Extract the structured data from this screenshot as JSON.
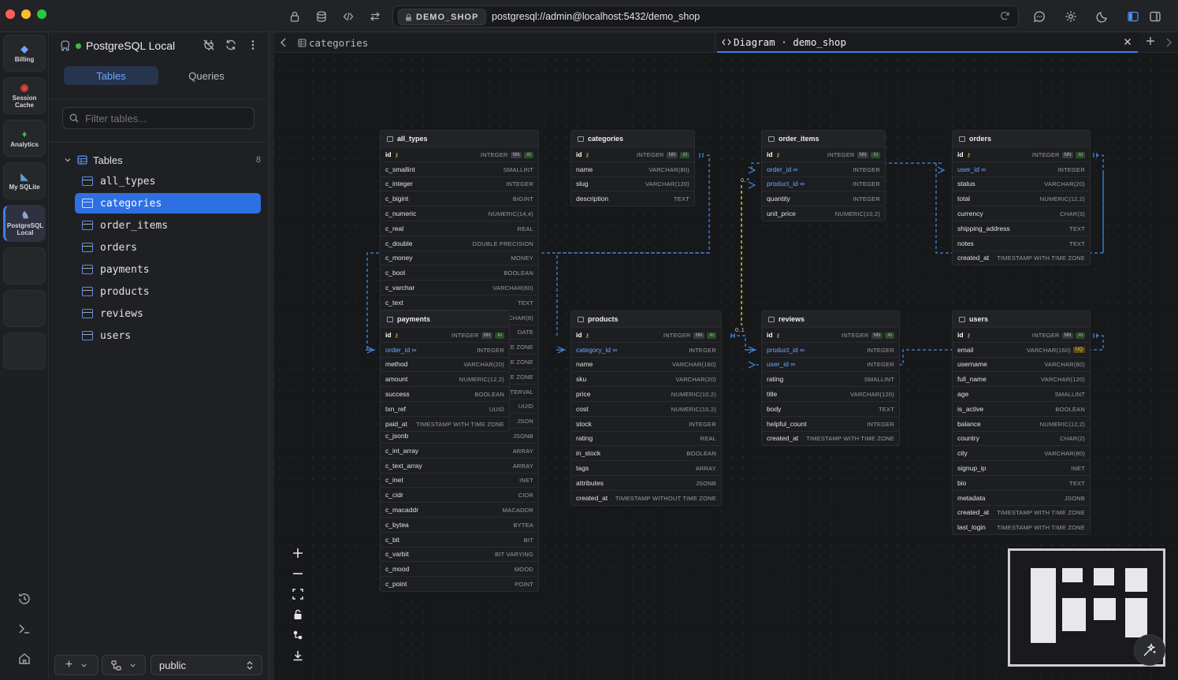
{
  "titlebar": {
    "connection_badge": "DEMO_SHOP",
    "url": "postgresql://admin@localhost:5432/demo_shop"
  },
  "activity_bar": {
    "items": [
      {
        "label": "Billing",
        "icon": "billing-icon"
      },
      {
        "label": "Session Cache",
        "icon": "redis-icon"
      },
      {
        "label": "Analytics",
        "icon": "leaf-icon"
      },
      {
        "label": "My SQLite",
        "icon": "sqlite-icon"
      },
      {
        "label": "PostgreSQL Local",
        "icon": "elephant-icon",
        "active": true
      }
    ]
  },
  "sidebar": {
    "connection_name": "PostgreSQL Local",
    "status_color": "#3fb950",
    "tabs": {
      "tables": "Tables",
      "queries": "Queries"
    },
    "filter_placeholder": "Filter tables...",
    "tree_header": {
      "label": "Tables",
      "count": "8"
    },
    "tables": [
      "all_types",
      "categories",
      "order_items",
      "orders",
      "payments",
      "products",
      "reviews",
      "users"
    ],
    "selected_table": "categories",
    "schema": "public"
  },
  "tabs": {
    "first": "categories",
    "active": "Diagram · demo_shop"
  },
  "diagram": {
    "all_types": {
      "name": "all_types",
      "columns": [
        {
          "n": "id",
          "t": "INTEGER",
          "nn": "NN",
          "ai": "AI"
        },
        {
          "n": "c_smallint",
          "t": "SMALLINT"
        },
        {
          "n": "c_integer",
          "t": "INTEGER"
        },
        {
          "n": "c_bigint",
          "t": "BIGINT"
        },
        {
          "n": "c_numeric",
          "t": "NUMERIC(14,4)"
        },
        {
          "n": "c_real",
          "t": "REAL"
        },
        {
          "n": "c_double",
          "t": "DOUBLE PRECISION"
        },
        {
          "n": "c_money",
          "t": "MONEY"
        },
        {
          "n": "c_bool",
          "t": "BOOLEAN"
        },
        {
          "n": "c_varchar",
          "t": "VARCHAR(60)"
        },
        {
          "n": "c_text",
          "t": "TEXT"
        },
        {
          "n": "",
          "t": "CHAR(8)"
        },
        {
          "n": "",
          "t": "DATE"
        },
        {
          "n": "",
          "t": "E ZONE"
        },
        {
          "n": "",
          "t": "E ZONE"
        },
        {
          "n": "",
          "t": "E ZONE"
        },
        {
          "n": "",
          "t": "TERVAL"
        },
        {
          "n": "",
          "t": "UUID"
        },
        {
          "n": "",
          "t": "JSON"
        },
        {
          "n": "c_jsonb",
          "t": "JSONB"
        },
        {
          "n": "c_int_array",
          "t": "ARRAY"
        },
        {
          "n": "c_text_array",
          "t": "ARRAY"
        },
        {
          "n": "c_inet",
          "t": "INET"
        },
        {
          "n": "c_cidr",
          "t": "CIDR"
        },
        {
          "n": "c_macaddr",
          "t": "MACADDR"
        },
        {
          "n": "c_bytea",
          "t": "BYTEA"
        },
        {
          "n": "c_bit",
          "t": "BIT"
        },
        {
          "n": "c_varbit",
          "t": "BIT VARYING"
        },
        {
          "n": "c_mood",
          "t": "MOOD"
        },
        {
          "n": "c_point",
          "t": "POINT"
        }
      ]
    },
    "categories": {
      "name": "categories",
      "columns": [
        {
          "n": "id",
          "t": "INTEGER",
          "nn": "NN",
          "ai": "AI"
        },
        {
          "n": "name",
          "t": "VARCHAR(80)"
        },
        {
          "n": "slug",
          "t": "VARCHAR(120)"
        },
        {
          "n": "description",
          "t": "TEXT"
        }
      ]
    },
    "order_items": {
      "name": "order_items",
      "columns": [
        {
          "n": "id",
          "t": "INTEGER",
          "nn": "NN",
          "ai": "AI"
        },
        {
          "n": "order_id",
          "t": "INTEGER",
          "fk": true
        },
        {
          "n": "product_id",
          "t": "INTEGER",
          "fk": true
        },
        {
          "n": "quantity",
          "t": "INTEGER"
        },
        {
          "n": "unit_price",
          "t": "NUMERIC(10,2)"
        }
      ]
    },
    "orders": {
      "name": "orders",
      "columns": [
        {
          "n": "id",
          "t": "INTEGER",
          "nn": "NN",
          "ai": "AI"
        },
        {
          "n": "user_id",
          "t": "INTEGER",
          "fk": true
        },
        {
          "n": "status",
          "t": "VARCHAR(20)"
        },
        {
          "n": "total",
          "t": "NUMERIC(12,2)"
        },
        {
          "n": "currency",
          "t": "CHAR(3)"
        },
        {
          "n": "shipping_address",
          "t": "TEXT"
        },
        {
          "n": "notes",
          "t": "TEXT"
        },
        {
          "n": "created_at",
          "t": "TIMESTAMP WITH TIME ZONE"
        }
      ]
    },
    "payments": {
      "name": "payments",
      "columns": [
        {
          "n": "id",
          "t": "INTEGER",
          "nn": "NN",
          "ai": "AI"
        },
        {
          "n": "order_id",
          "t": "INTEGER",
          "fk": true
        },
        {
          "n": "method",
          "t": "VARCHAR(20)"
        },
        {
          "n": "amount",
          "t": "NUMERIC(12,2)"
        },
        {
          "n": "success",
          "t": "BOOLEAN"
        },
        {
          "n": "txn_ref",
          "t": "UUID"
        },
        {
          "n": "paid_at",
          "t": "TIMESTAMP WITH TIME ZONE"
        }
      ]
    },
    "products": {
      "name": "products",
      "columns": [
        {
          "n": "id",
          "t": "INTEGER",
          "nn": "NN",
          "ai": "AI"
        },
        {
          "n": "category_id",
          "t": "INTEGER",
          "fk": true
        },
        {
          "n": "name",
          "t": "VARCHAR(160)"
        },
        {
          "n": "sku",
          "t": "VARCHAR(20)"
        },
        {
          "n": "price",
          "t": "NUMERIC(10,2)"
        },
        {
          "n": "cost",
          "t": "NUMERIC(10,2)"
        },
        {
          "n": "stock",
          "t": "INTEGER"
        },
        {
          "n": "rating",
          "t": "REAL"
        },
        {
          "n": "in_stock",
          "t": "BOOLEAN"
        },
        {
          "n": "tags",
          "t": "ARRAY"
        },
        {
          "n": "attributes",
          "t": "JSONB"
        },
        {
          "n": "created_at",
          "t": "TIMESTAMP WITHOUT TIME ZONE"
        }
      ]
    },
    "reviews": {
      "name": "reviews",
      "columns": [
        {
          "n": "id",
          "t": "INTEGER",
          "nn": "NN",
          "ai": "AI"
        },
        {
          "n": "product_id",
          "t": "INTEGER",
          "fk": true
        },
        {
          "n": "user_id",
          "t": "INTEGER",
          "fk": true
        },
        {
          "n": "rating",
          "t": "SMALLINT"
        },
        {
          "n": "title",
          "t": "VARCHAR(120)"
        },
        {
          "n": "body",
          "t": "TEXT"
        },
        {
          "n": "helpful_count",
          "t": "INTEGER"
        },
        {
          "n": "created_at",
          "t": "TIMESTAMP WITH TIME ZONE"
        }
      ]
    },
    "users": {
      "name": "users",
      "columns": [
        {
          "n": "id",
          "t": "INTEGER",
          "nn": "NN",
          "ai": "AI"
        },
        {
          "n": "email",
          "t": "VARCHAR(160)",
          "uq": "UQ"
        },
        {
          "n": "username",
          "t": "VARCHAR(80)"
        },
        {
          "n": "full_name",
          "t": "VARCHAR(120)"
        },
        {
          "n": "age",
          "t": "SMALLINT"
        },
        {
          "n": "is_active",
          "t": "BOOLEAN"
        },
        {
          "n": "balance",
          "t": "NUMERIC(12,2)"
        },
        {
          "n": "country",
          "t": "CHAR(2)"
        },
        {
          "n": "city",
          "t": "VARCHAR(80)"
        },
        {
          "n": "signup_ip",
          "t": "INET"
        },
        {
          "n": "bio",
          "t": "TEXT"
        },
        {
          "n": "metadata",
          "t": "JSONB"
        },
        {
          "n": "created_at",
          "t": "TIMESTAMP WITH TIME ZONE"
        },
        {
          "n": "last_login",
          "t": "TIMESTAMP WITH TIME ZONE"
        }
      ]
    },
    "cardinality_labels": [
      "0..*",
      "0..1"
    ],
    "colors": {
      "relation": "#3f8cf0",
      "relation_highlight": "#e8c240",
      "accent": "#2f6fe4"
    }
  }
}
